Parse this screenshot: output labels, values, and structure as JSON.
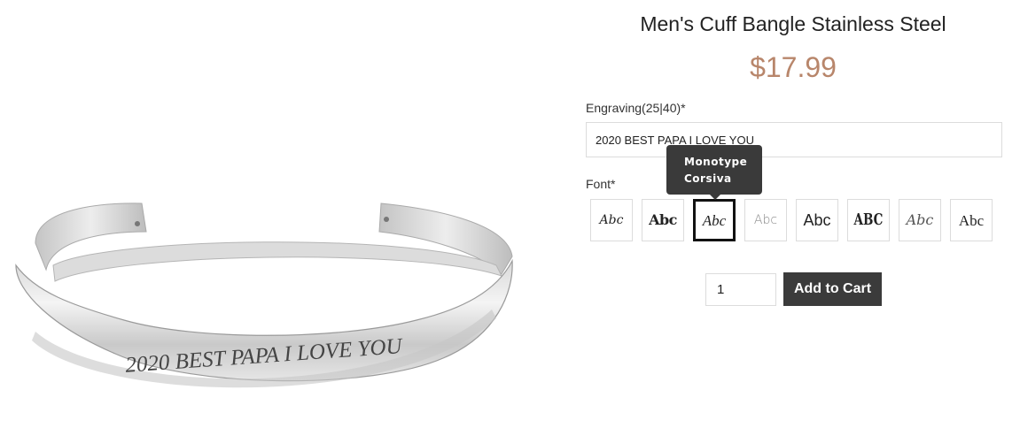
{
  "product": {
    "title": "Men's Cuff Bangle Stainless Steel",
    "price": "$17.99",
    "image_engraving": "2020 BEST PAPA I LOVE YOU"
  },
  "engraving": {
    "label": "Engraving(25|40)*",
    "value": "2020 BEST PAPA I LOVE YOU"
  },
  "font": {
    "label": "Font*",
    "options": [
      {
        "sample": "Abc",
        "selected": false
      },
      {
        "sample": "Abc",
        "selected": false
      },
      {
        "sample": "Abc",
        "selected": true
      },
      {
        "sample": "Abc",
        "selected": false
      },
      {
        "sample": "Abc",
        "selected": false
      },
      {
        "sample": "ABC",
        "selected": false
      },
      {
        "sample": "Abc",
        "selected": false
      },
      {
        "sample": "Abc",
        "selected": false
      }
    ],
    "tooltip": {
      "line1": "Monotype",
      "line2": "Corsiva"
    }
  },
  "cart": {
    "quantity": "1",
    "add_label": "Add to Cart"
  },
  "colors": {
    "price": "#b8866b",
    "button": "#3b3b3b",
    "tooltip": "#3a3a3a"
  }
}
